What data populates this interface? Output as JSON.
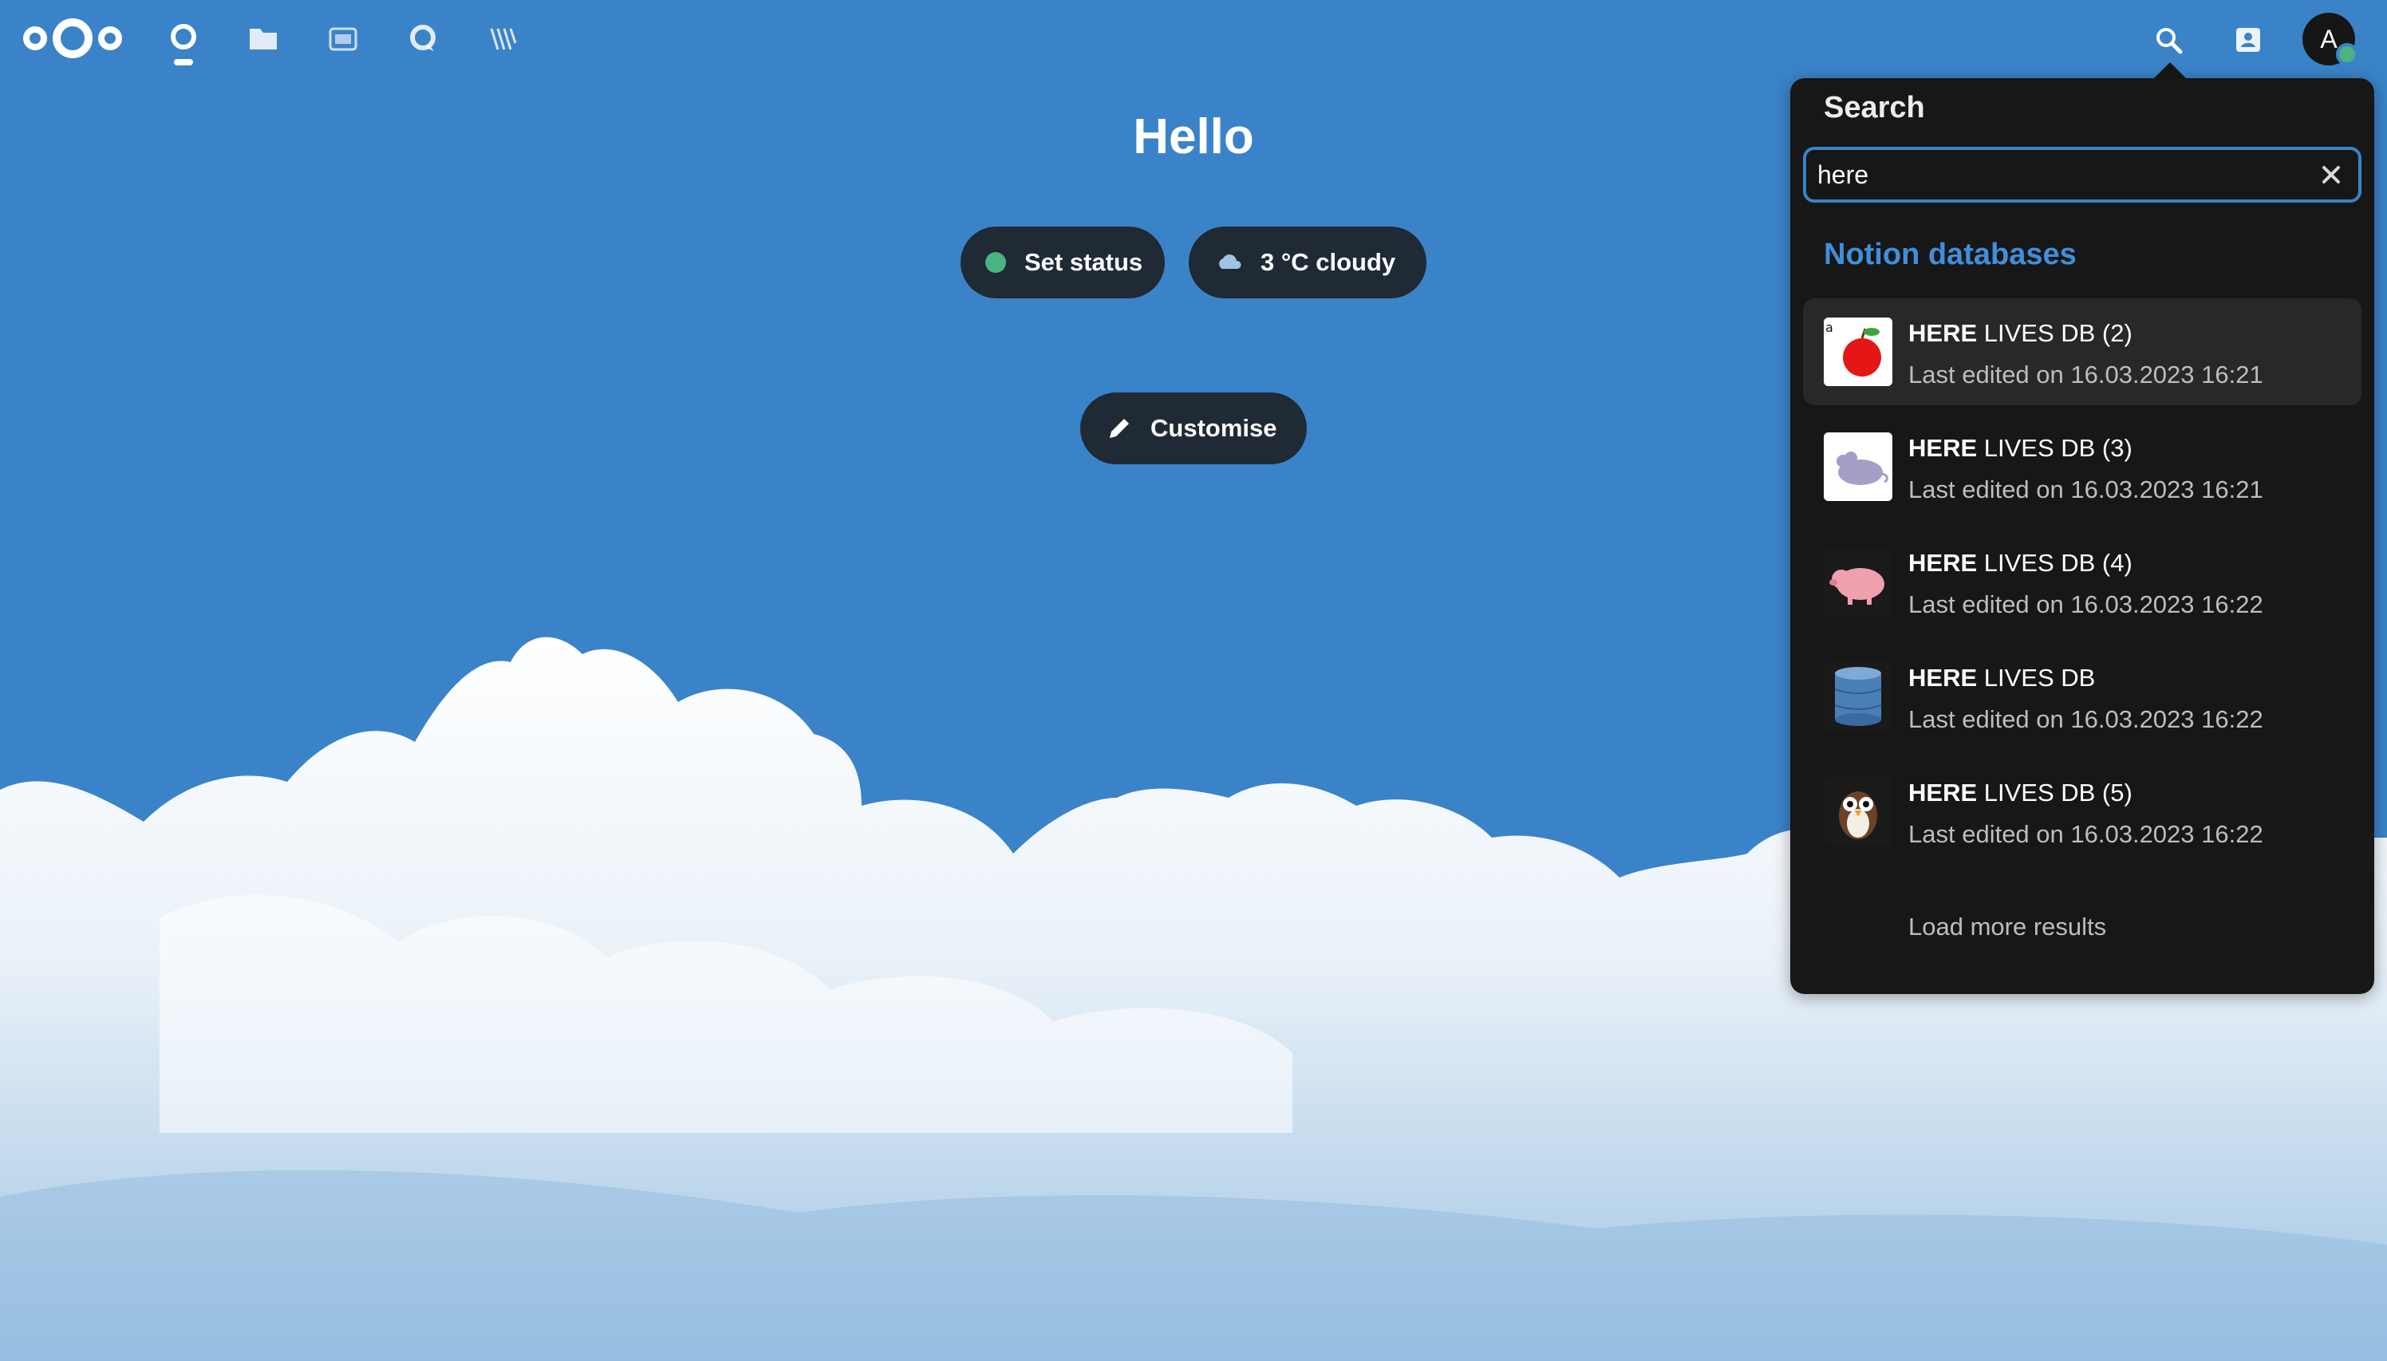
{
  "header": {
    "apps": [
      {
        "name": "dashboard",
        "icon": "dashboard-icon",
        "active": true
      },
      {
        "name": "files",
        "icon": "folder-icon",
        "active": false
      },
      {
        "name": "photos",
        "icon": "photos-icon",
        "active": false
      },
      {
        "name": "talk",
        "icon": "talk-icon",
        "active": false
      },
      {
        "name": "activity",
        "icon": "activity-icon",
        "active": false
      }
    ],
    "right": {
      "search_icon": "search-icon",
      "contacts_icon": "contacts-icon",
      "avatar_initial": "A"
    }
  },
  "main": {
    "greeting": "Hello",
    "status_button": "Set status",
    "weather_button": "3 °C cloudy",
    "customise_button": "Customise"
  },
  "search": {
    "title": "Search",
    "query": "here",
    "section": "Notion databases",
    "results": [
      {
        "match": "HERE",
        "rest": " LIVES DB (2)",
        "subtitle": "Last edited on 16.03.2023 16:21",
        "thumb": "apple"
      },
      {
        "match": "HERE",
        "rest": " LIVES DB (3)",
        "subtitle": "Last edited on 16.03.2023 16:21",
        "thumb": "mouse"
      },
      {
        "match": "HERE",
        "rest": " LIVES DB (4)",
        "subtitle": "Last edited on 16.03.2023 16:22",
        "thumb": "pig"
      },
      {
        "match": "HERE",
        "rest": " LIVES DB",
        "subtitle": "Last edited on 16.03.2023 16:22",
        "thumb": "database"
      },
      {
        "match": "HERE",
        "rest": " LIVES DB (5)",
        "subtitle": "Last edited on 16.03.2023 16:22",
        "thumb": "owl"
      }
    ],
    "load_more": "Load more results"
  },
  "colors": {
    "background": "#3a83c8",
    "popover": "#171717",
    "accent": "#3f8fdb",
    "status_online": "#49b382"
  }
}
